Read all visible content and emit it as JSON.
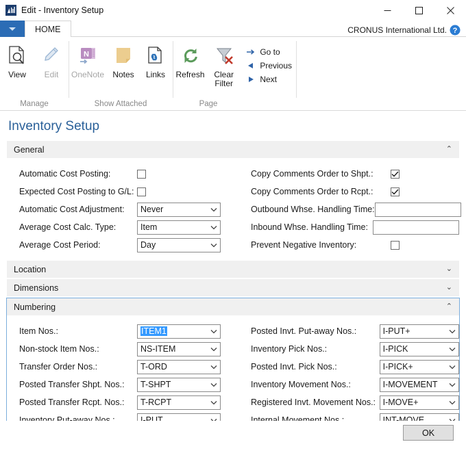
{
  "window": {
    "title": "Edit - Inventory Setup",
    "app_icon": "dynamics-nav-icon",
    "minimize_label": "─",
    "maximize_label": "☐",
    "close_label": "✕"
  },
  "ribbon": {
    "quick_access_label": "▼",
    "tabs": [
      {
        "label": "HOME",
        "active": true
      }
    ],
    "company": "CRONUS International Ltd.",
    "help_label": "?",
    "groups": [
      {
        "label": "Manage",
        "buttons": [
          {
            "label": "View",
            "icon": "view-document-search-icon",
            "disabled": false
          },
          {
            "label": "Edit",
            "icon": "edit-pencil-icon",
            "disabled": true
          }
        ]
      },
      {
        "label": "Show Attached",
        "buttons": [
          {
            "label": "OneNote",
            "icon": "onenote-icon",
            "disabled": true
          },
          {
            "label": "Notes",
            "icon": "notes-sticky-icon",
            "disabled": false
          },
          {
            "label": "Links",
            "icon": "links-chain-icon",
            "disabled": false
          }
        ]
      },
      {
        "label": "Page",
        "buttons": [
          {
            "label": "Refresh",
            "icon": "refresh-icon",
            "disabled": false
          },
          {
            "label": "Clear Filter",
            "icon": "clear-filter-icon",
            "disabled": false
          }
        ],
        "small_items": [
          {
            "label": "Go to",
            "icon": "arrow-right-icon"
          },
          {
            "label": "Previous",
            "icon": "arrow-left-icon"
          },
          {
            "label": "Next",
            "icon": "arrow-right-solid-icon"
          }
        ]
      }
    ]
  },
  "page": {
    "title": "Inventory Setup",
    "sections": [
      {
        "name": "General",
        "label": "General",
        "expanded": true,
        "focused": false,
        "chevron": "⌃"
      },
      {
        "name": "Location",
        "label": "Location",
        "expanded": false,
        "focused": false,
        "chevron": "⌄"
      },
      {
        "name": "Dimensions",
        "label": "Dimensions",
        "expanded": false,
        "focused": false,
        "chevron": "⌄"
      },
      {
        "name": "Numbering",
        "label": "Numbering",
        "expanded": true,
        "focused": true,
        "chevron": "⌃"
      }
    ]
  },
  "general": {
    "left_fields": [
      {
        "label": "Automatic Cost Posting:",
        "type": "checkbox",
        "checked": false,
        "name": "automatic-cost-posting"
      },
      {
        "label": "Expected Cost Posting to G/L:",
        "type": "checkbox",
        "checked": false,
        "name": "expected-cost-posting-to-gl"
      },
      {
        "label": "Automatic Cost Adjustment:",
        "type": "combo",
        "value": "Never",
        "name": "automatic-cost-adjustment"
      },
      {
        "label": "Average Cost Calc. Type:",
        "type": "combo",
        "value": "Item",
        "name": "average-cost-calc-type"
      },
      {
        "label": "Average Cost Period:",
        "type": "combo",
        "value": "Day",
        "name": "average-cost-period"
      }
    ],
    "right_fields": [
      {
        "label": "Copy Comments Order to Shpt.:",
        "type": "checkbox",
        "checked": true,
        "name": "copy-comments-order-to-shpt"
      },
      {
        "label": "Copy Comments Order to Rcpt.:",
        "type": "checkbox",
        "checked": true,
        "name": "copy-comments-order-to-rcpt"
      },
      {
        "label": "Outbound Whse. Handling Time:",
        "type": "text",
        "value": "",
        "name": "outbound-whse-handling-time"
      },
      {
        "label": "Inbound Whse. Handling Time:",
        "type": "text",
        "value": "",
        "name": "inbound-whse-handling-time"
      },
      {
        "label": "Prevent Negative Inventory:",
        "type": "checkbox",
        "checked": false,
        "name": "prevent-negative-inventory"
      }
    ]
  },
  "numbering": {
    "left_fields": [
      {
        "label": "Item Nos.:",
        "value": "ITEM1",
        "selected": true,
        "name": "item-nos"
      },
      {
        "label": "Non-stock Item Nos.:",
        "value": "NS-ITEM",
        "selected": false,
        "name": "non-stock-item-nos"
      },
      {
        "label": "Transfer Order Nos.:",
        "value": "T-ORD",
        "selected": false,
        "name": "transfer-order-nos"
      },
      {
        "label": "Posted Transfer Shpt. Nos.:",
        "value": "T-SHPT",
        "selected": false,
        "name": "posted-transfer-shpt-nos"
      },
      {
        "label": "Posted Transfer Rcpt. Nos.:",
        "value": "T-RCPT",
        "selected": false,
        "name": "posted-transfer-rcpt-nos"
      },
      {
        "label": "Inventory Put-away Nos.:",
        "value": "I-PUT",
        "selected": false,
        "name": "inventory-put-away-nos"
      }
    ],
    "right_fields": [
      {
        "label": "Posted Invt. Put-away Nos.:",
        "value": "I-PUT+",
        "selected": false,
        "name": "posted-invt-put-away-nos"
      },
      {
        "label": "Inventory Pick Nos.:",
        "value": "I-PICK",
        "selected": false,
        "name": "inventory-pick-nos"
      },
      {
        "label": "Posted Invt. Pick Nos.:",
        "value": "I-PICK+",
        "selected": false,
        "name": "posted-invt-pick-nos"
      },
      {
        "label": "Inventory Movement Nos.:",
        "value": "I-MOVEMENT",
        "selected": false,
        "name": "inventory-movement-nos"
      },
      {
        "label": "Registered Invt. Movement Nos.:",
        "value": "I-MOVE+",
        "selected": false,
        "name": "registered-invt-movement-nos"
      },
      {
        "label": "Internal Movement Nos.:",
        "value": "INT-MOVE",
        "selected": false,
        "name": "internal-movement-nos"
      }
    ]
  },
  "footer": {
    "ok_label": "OK"
  },
  "colors": {
    "accent": "#2a6099",
    "ribbon_blue": "#2b6cb5",
    "selection_blue": "#3399ff",
    "focus_border": "#7aaddc",
    "group_header_bg": "#f0f0f0"
  }
}
